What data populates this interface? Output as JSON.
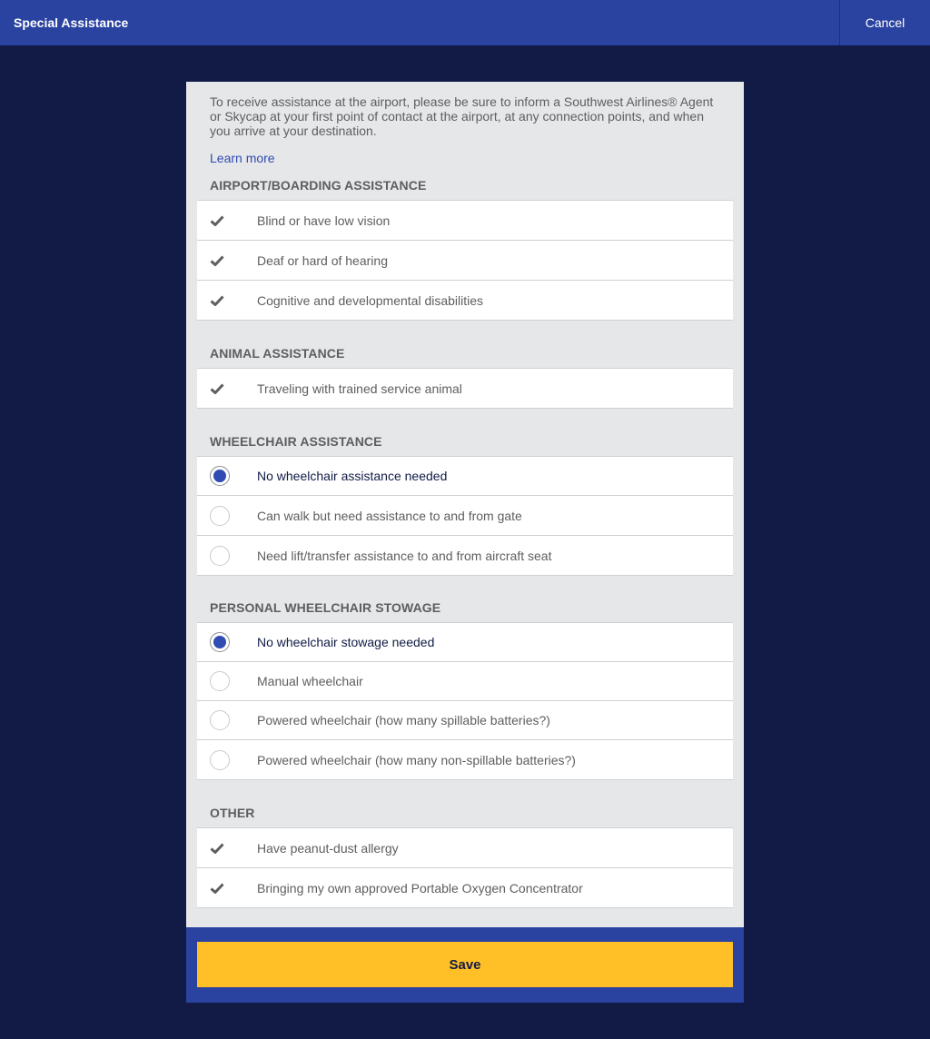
{
  "header": {
    "title": "Special Assistance",
    "cancel_label": "Cancel"
  },
  "intro": {
    "text": "To receive assistance at the airport, please be sure to inform a Southwest Airlines® Agent or Skycap at your first point of contact at the airport, at any connection points, and when you arrive at your destination.",
    "learn_more": "Learn more"
  },
  "sections": {
    "airport": {
      "title": "AIRPORT/BOARDING ASSISTANCE",
      "items": [
        {
          "label": "Blind or have low vision",
          "icon": "check-icon"
        },
        {
          "label": "Deaf or hard of hearing",
          "icon": "check-icon"
        },
        {
          "label": "Cognitive and developmental disabilities",
          "icon": "check-icon"
        }
      ]
    },
    "animal": {
      "title": "ANIMAL ASSISTANCE",
      "items": [
        {
          "label": "Traveling with trained service animal",
          "icon": "check-icon"
        }
      ]
    },
    "wheelchair": {
      "title": "WHEELCHAIR ASSISTANCE",
      "selected_index": 0,
      "items": [
        {
          "label": "No wheelchair assistance needed"
        },
        {
          "label": "Can walk but need assistance to and from gate"
        },
        {
          "label": "Need lift/transfer assistance to and from aircraft seat"
        }
      ]
    },
    "stowage": {
      "title": "PERSONAL WHEELCHAIR STOWAGE",
      "selected_index": 0,
      "items": [
        {
          "label": "No wheelchair stowage needed"
        },
        {
          "label": "Manual wheelchair"
        },
        {
          "label": "Powered wheelchair (how many spillable batteries?)"
        },
        {
          "label": "Powered wheelchair (how many non-spillable batteries?)"
        }
      ]
    },
    "other": {
      "title": "OTHER",
      "items": [
        {
          "label": "Have peanut-dust allergy",
          "icon": "check-icon"
        },
        {
          "label": "Bringing my own approved Portable Oxygen Concentrator",
          "icon": "check-icon"
        }
      ]
    }
  },
  "footer": {
    "save_label": "Save"
  },
  "colors": {
    "header_bg": "#2a43a0",
    "page_bg": "#111b45",
    "accent_blue": "#304cb2",
    "save_yellow": "#ffbf27"
  }
}
